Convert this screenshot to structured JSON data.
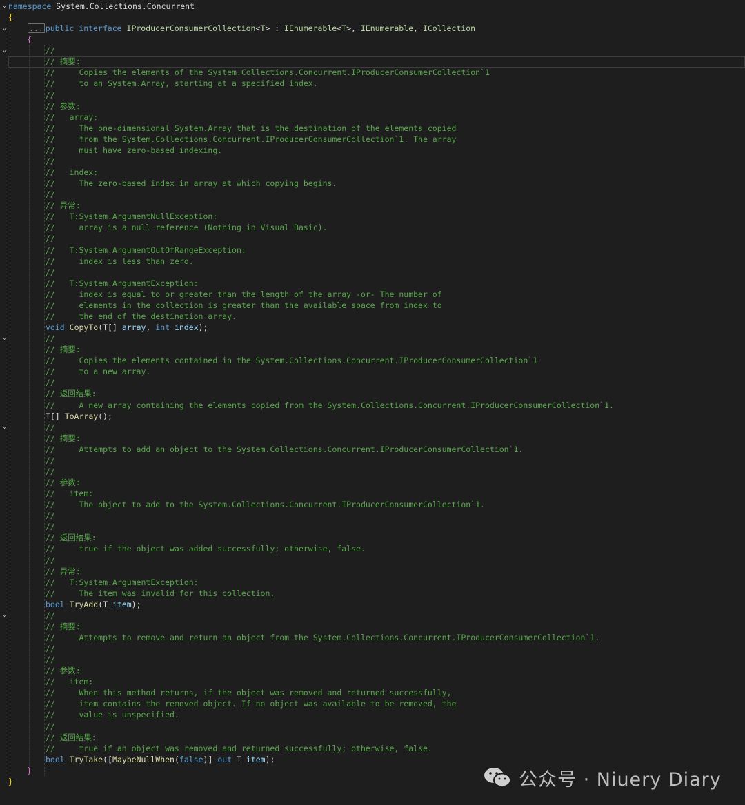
{
  "editor": {
    "lines": [
      {
        "text": "namespace System.Collections.Concurrent"
      },
      {
        "text": "{"
      },
      {
        "text": "public interface IProducerConsumerCollection<T> : IEnumerable<T>, IEnumerable, ICollection"
      },
      {
        "text": "{"
      },
      {
        "text": "//"
      },
      {
        "text": "// 摘要:"
      },
      {
        "text": "//     Copies the elements of the System.Collections.Concurrent.IProducerConsumerCollection`1"
      },
      {
        "text": "//     to an System.Array, starting at a specified index."
      },
      {
        "text": "//"
      },
      {
        "text": "// 参数:"
      },
      {
        "text": "//   array:"
      },
      {
        "text": "//     The one-dimensional System.Array that is the destination of the elements copied"
      },
      {
        "text": "//     from the System.Collections.Concurrent.IProducerConsumerCollection`1. The array"
      },
      {
        "text": "//     must have zero-based indexing."
      },
      {
        "text": "//"
      },
      {
        "text": "//   index:"
      },
      {
        "text": "//     The zero-based index in array at which copying begins."
      },
      {
        "text": "//"
      },
      {
        "text": "// 异常:"
      },
      {
        "text": "//   T:System.ArgumentNullException:"
      },
      {
        "text": "//     array is a null reference (Nothing in Visual Basic)."
      },
      {
        "text": "//"
      },
      {
        "text": "//   T:System.ArgumentOutOfRangeException:"
      },
      {
        "text": "//     index is less than zero."
      },
      {
        "text": "//"
      },
      {
        "text": "//   T:System.ArgumentException:"
      },
      {
        "text": "//     index is equal to or greater than the length of the array -or- The number of"
      },
      {
        "text": "//     elements in the collection is greater than the available space from index to"
      },
      {
        "text": "//     the end of the destination array."
      },
      {
        "text": "void CopyTo(T[] array, int index);"
      },
      {
        "text": "//"
      },
      {
        "text": "// 摘要:"
      },
      {
        "text": "//     Copies the elements contained in the System.Collections.Concurrent.IProducerConsumerCollection`1"
      },
      {
        "text": "//     to a new array."
      },
      {
        "text": "//"
      },
      {
        "text": "// 返回结果:"
      },
      {
        "text": "//     A new array containing the elements copied from the System.Collections.Concurrent.IProducerConsumerCollection`1."
      },
      {
        "text": "T[] ToArray();"
      },
      {
        "text": "//"
      },
      {
        "text": "// 摘要:"
      },
      {
        "text": "//     Attempts to add an object to the System.Collections.Concurrent.IProducerConsumerCollection`1."
      },
      {
        "text": "//"
      },
      {
        "text": "//"
      },
      {
        "text": "// 参数:"
      },
      {
        "text": "//   item:"
      },
      {
        "text": "//     The object to add to the System.Collections.Concurrent.IProducerConsumerCollection`1."
      },
      {
        "text": "//"
      },
      {
        "text": "//"
      },
      {
        "text": "// 返回结果:"
      },
      {
        "text": "//     true if the object was added successfully; otherwise, false."
      },
      {
        "text": "//"
      },
      {
        "text": "// 异常:"
      },
      {
        "text": "//   T:System.ArgumentException:"
      },
      {
        "text": "//     The item was invalid for this collection."
      },
      {
        "text": "bool TryAdd(T item);"
      },
      {
        "text": "//"
      },
      {
        "text": "// 摘要:"
      },
      {
        "text": "//     Attempts to remove and return an object from the System.Collections.Concurrent.IProducerConsumerCollection`1."
      },
      {
        "text": "//"
      },
      {
        "text": "//"
      },
      {
        "text": "// 参数:"
      },
      {
        "text": "//   item:"
      },
      {
        "text": "//     When this method returns, if the object was removed and returned successfully,"
      },
      {
        "text": "//     item contains the removed object. If no object was available to be removed, the"
      },
      {
        "text": "//     value is unspecified."
      },
      {
        "text": "//"
      },
      {
        "text": "// 返回结果:"
      },
      {
        "text": "//     true if an object was removed and returned successfully; otherwise, false."
      },
      {
        "text": "bool TryTake([MaybeNullWhen(false)] out T item);"
      },
      {
        "text": "}"
      },
      {
        "text": "}"
      }
    ],
    "collapsed_marker": "..."
  },
  "watermark": {
    "text": "公众号 · Niuery Diary",
    "icon": "wechat-icon"
  },
  "colors": {
    "background": "#1e1e1e",
    "keyword": "#569cd6",
    "comment": "#57a64a",
    "type": "#b8d7a3",
    "method": "#dcdcaa",
    "parameter": "#9cdcfe"
  }
}
